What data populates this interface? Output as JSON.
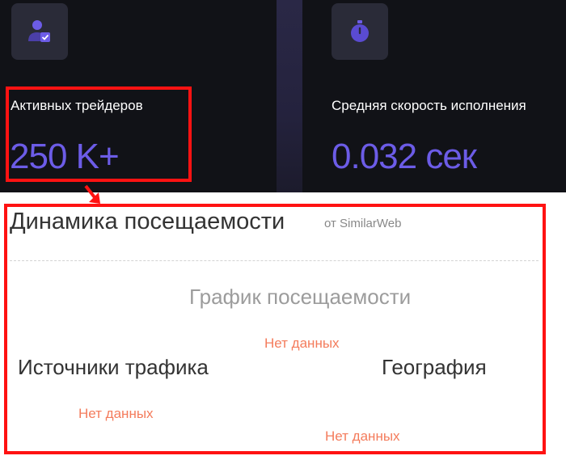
{
  "colors": {
    "dark_bg": "#111217",
    "accent": "#6c5ce7",
    "tile_bg": "#2a2b38",
    "annotation_red": "#ff1212",
    "no_data": "#f47c5c"
  },
  "stats": [
    {
      "icon": "user-check-icon",
      "label": "Активных трейдеров",
      "value": "250 K+"
    },
    {
      "icon": "stopwatch-icon",
      "label": "Средняя скорость исполнения",
      "value": "0.032 сек"
    }
  ],
  "attendance": {
    "title": "Динамика посещаемости",
    "source": "от SimilarWeb",
    "traffic_graph_title": "График посещаемости",
    "traffic_graph_status": "Нет данных",
    "sources_title": "Источники трафика",
    "sources_status": "Нет данных",
    "geo_title": "География",
    "geo_status": "Нет данных"
  }
}
